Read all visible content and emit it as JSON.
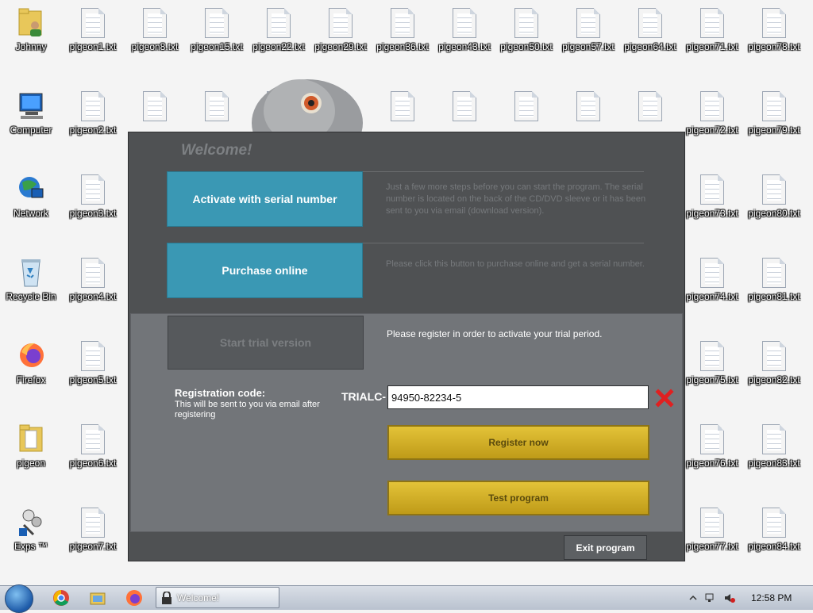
{
  "desktop": {
    "icons": [
      {
        "label": "Johnny",
        "type": "folder-user"
      },
      {
        "label": "Computer",
        "type": "computer"
      },
      {
        "label": "Network",
        "type": "network"
      },
      {
        "label": "Recycle Bin",
        "type": "recycle"
      },
      {
        "label": "Firefox",
        "type": "firefox"
      },
      {
        "label": "pigeon",
        "type": "folder"
      },
      {
        "label": "Exps ™",
        "type": "exps"
      }
    ],
    "files_col": [
      [
        "pigeon1.txt",
        "pigeon2.txt",
        "pigeon3.txt",
        "pigeon4.txt",
        "pigeon5.txt",
        "pigeon6.txt",
        "pigeon7.txt"
      ]
    ],
    "top_row": [
      "pigeon8.txt",
      "pigeon15.txt",
      "pigeon22.txt",
      "pigeon29.txt",
      "pigeon36.txt",
      "pigeon43.txt",
      "pigeon50.txt",
      "pigeon57.txt",
      "pigeon64.txt",
      "pigeon71.txt",
      "pigeon78.txt"
    ],
    "right_col1": [
      "pigeon72.txt",
      "pigeon73.txt",
      "pigeon74.txt",
      "pigeon75.txt",
      "pigeon76.txt",
      "pigeon77.txt"
    ],
    "right_col2": [
      "pigeon79.txt",
      "pigeon80.txt",
      "pigeon81.txt",
      "pigeon82.txt",
      "pigeon83.txt",
      "pigeon84.txt"
    ]
  },
  "dialog": {
    "title": "Welcome!",
    "activate_label": "Activate with serial number",
    "activate_desc": "Just a few more steps before you can start the program. The serial number is located on the back of the CD/DVD sleeve or it has been sent to you via email (download version).",
    "purchase_label": "Purchase online",
    "purchase_desc": "Please click this button to purchase online and get a serial number.",
    "trial_label": "Start trial version",
    "trial_msg": "Please register in order to activate your trial period.",
    "reg_title": "Registration code:",
    "reg_sub": "This will be sent to you via email after registering",
    "prefix": "TRIALC-",
    "code_value": "94950-82234-5",
    "register_label": "Register now",
    "test_label": "Test program",
    "exit_label": "Exit program"
  },
  "taskbar": {
    "task_label": "Welcome!",
    "clock": "12:58 PM"
  },
  "colors": {
    "teal": "#3a98b4",
    "gold": "#d4b02a",
    "dialog_bg": "#4f5153",
    "panel_bg": "#727579"
  }
}
